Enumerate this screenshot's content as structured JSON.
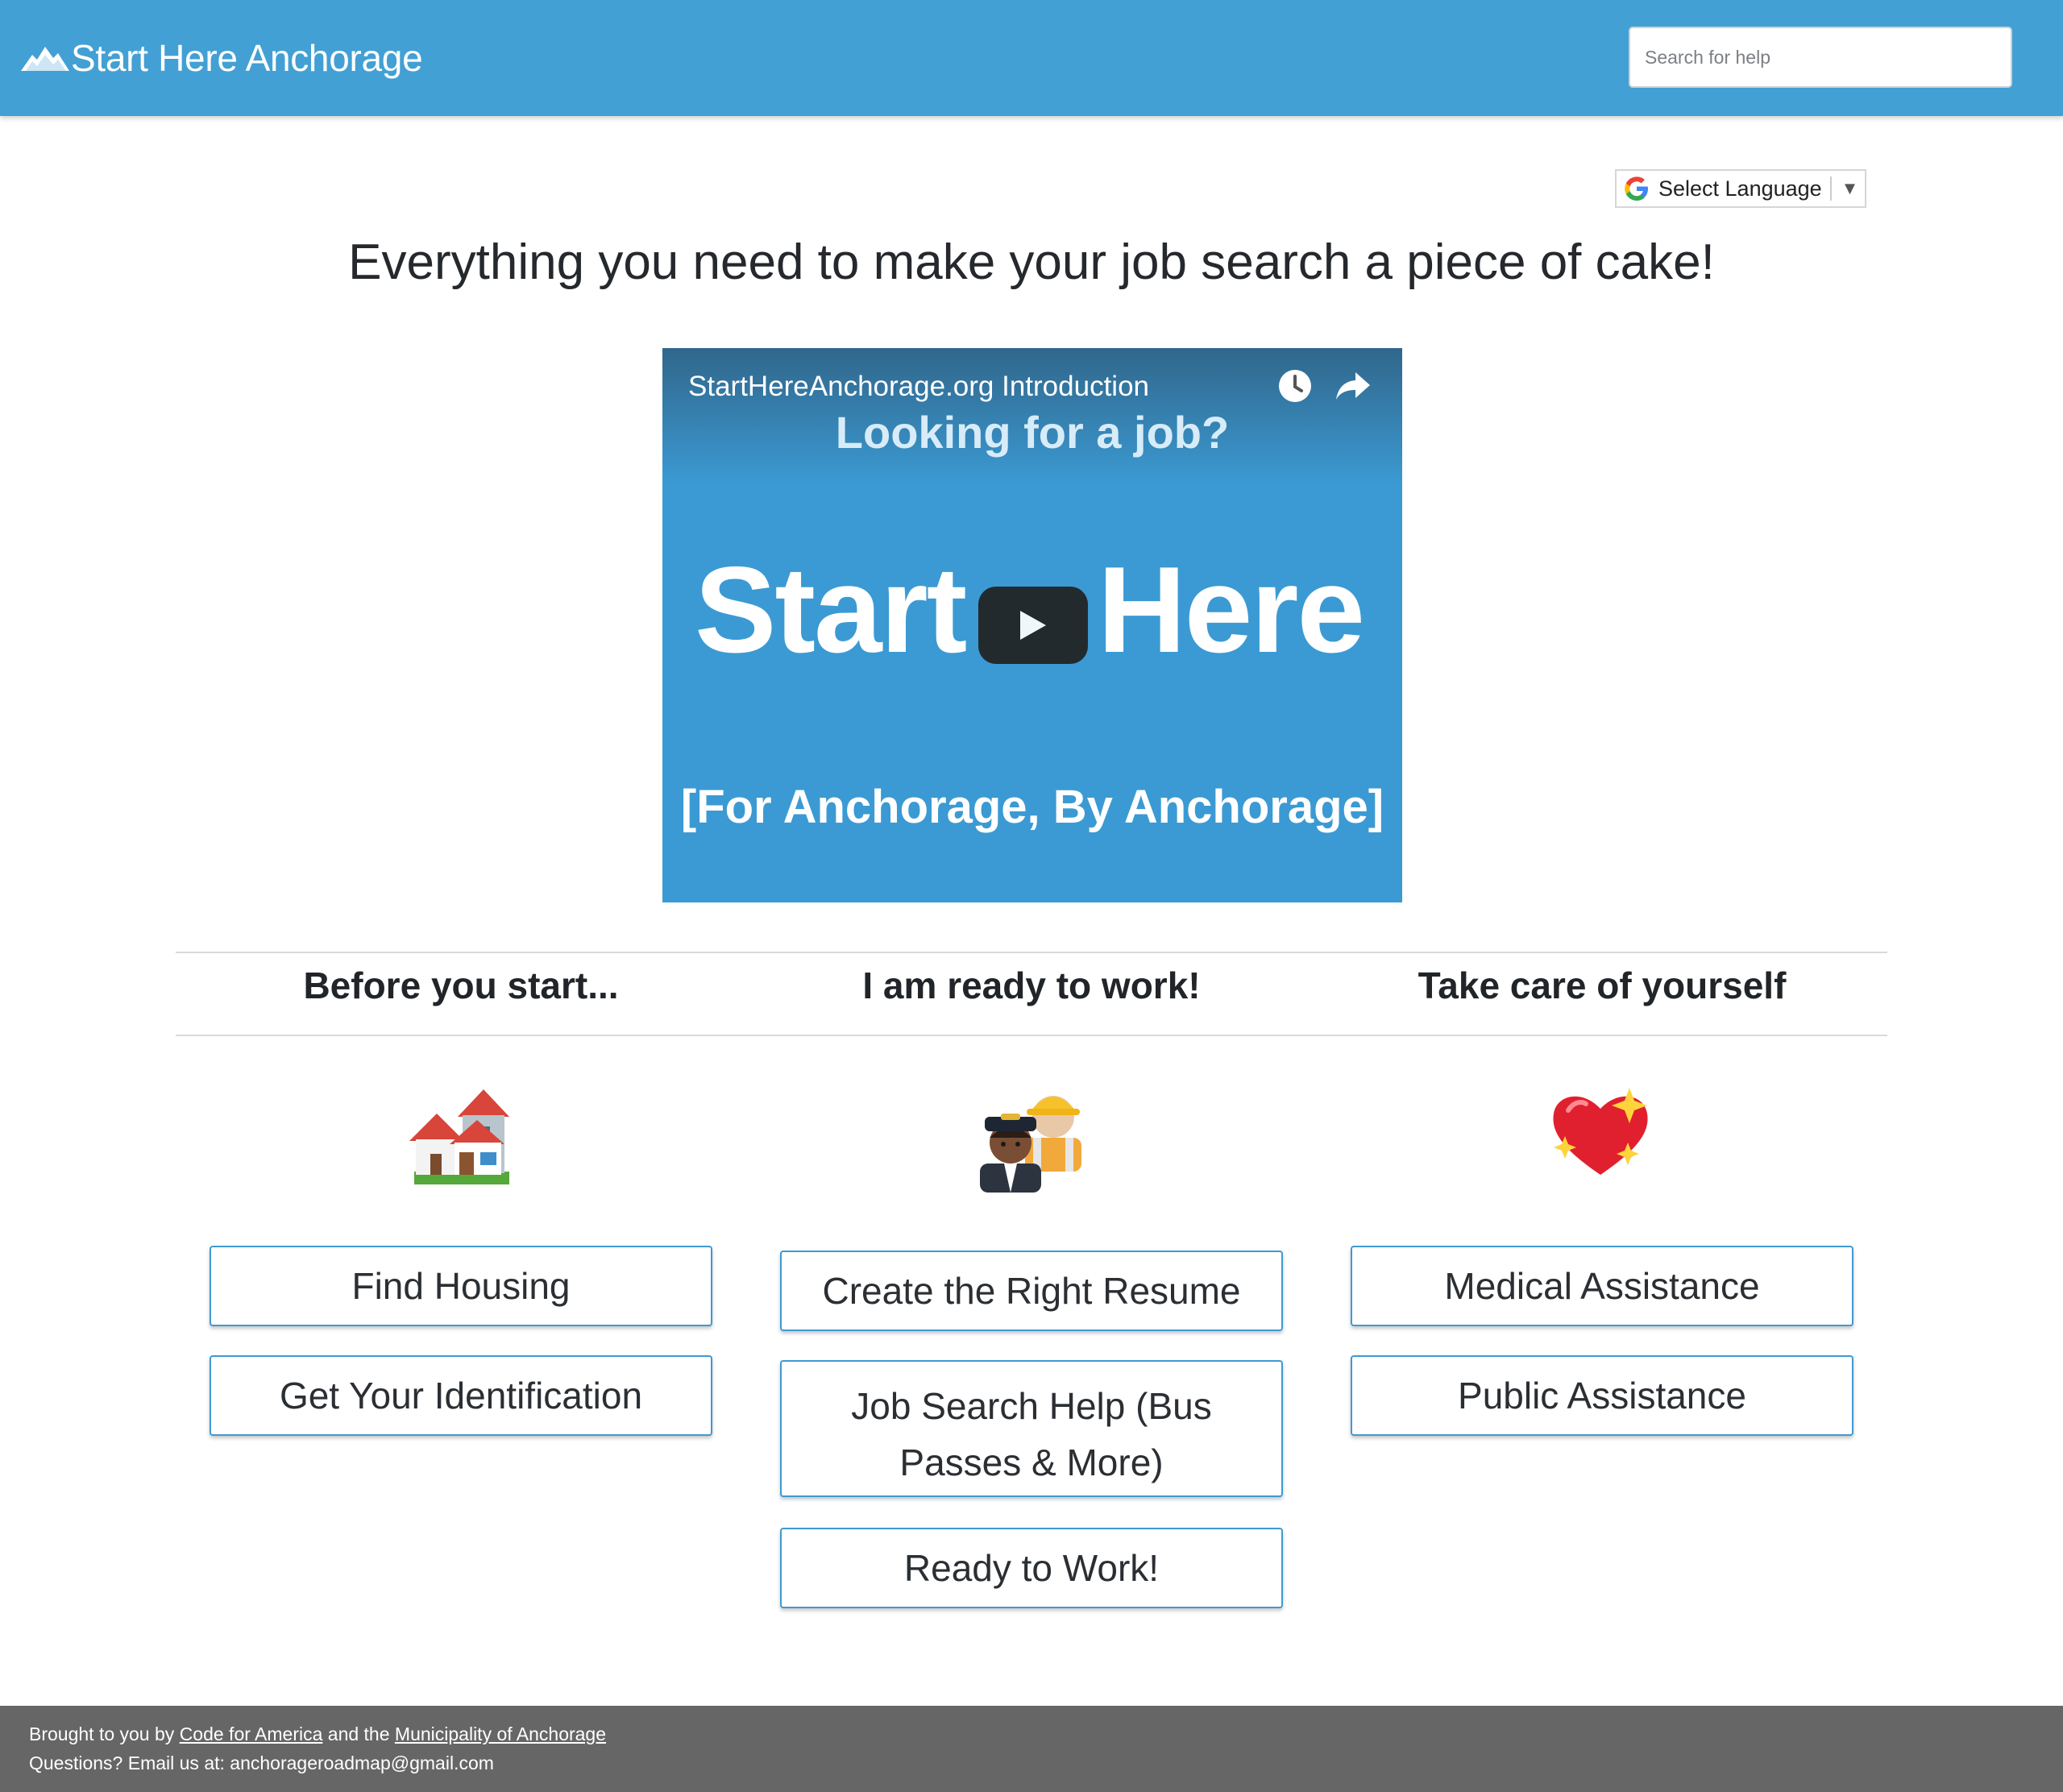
{
  "header": {
    "brand": "Start Here Anchorage",
    "brand_icon": "mountain-icon",
    "search_placeholder": "Search for help"
  },
  "language": {
    "label": "Select Language",
    "icon": "google-icon"
  },
  "headline": "Everything you need to make your job search a piece of cake!",
  "video": {
    "title": "StartHereAnchorage.org Introduction",
    "subtitle": "Looking for a job?",
    "main_left": "Start",
    "main_right": "Here",
    "tagline": "[For Anchorage, By Anchorage]",
    "icons": [
      "watch-later-icon",
      "share-icon",
      "play-icon"
    ]
  },
  "columns": [
    {
      "heading": "Before you start...",
      "icon": "houses-icon",
      "buttons": [
        "Find Housing",
        "Get Your Identification"
      ]
    },
    {
      "heading": "I am ready to work!",
      "icon": "workers-icon",
      "buttons": [
        "Create the Right Resume",
        "Job Search Help (Bus Passes & More)",
        "Ready to Work!"
      ]
    },
    {
      "heading": "Take care of yourself",
      "icon": "sparkling-heart-icon",
      "buttons": [
        "Medical Assistance",
        "Public Assistance"
      ]
    }
  ],
  "footer": {
    "prefix": "Brought to you by",
    "link1": "Code for America",
    "middle": "and the",
    "link2": "Municipality of Anchorage",
    "line2": "Questions? Email us at: anchorageroadmap@gmail.com"
  },
  "colors": {
    "header": "#42a0d4",
    "video": "#3b9ad3",
    "button_border": "#3f9ad1",
    "footer": "#666666"
  }
}
